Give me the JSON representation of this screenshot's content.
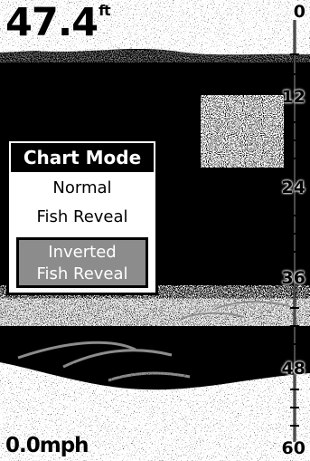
{
  "depth": {
    "value": "47.4",
    "unit": "ft"
  },
  "speed": {
    "value": "0.0mph"
  },
  "depth_scale": {
    "labels": [
      "0",
      "12",
      "24",
      "36",
      "48",
      "60"
    ]
  },
  "chart_mode_menu": {
    "title": "Chart Mode",
    "items": [
      {
        "label": "Normal",
        "selected": false
      },
      {
        "label": "Fish Reveal",
        "selected": false
      },
      {
        "label_line1": "Inverted",
        "label_line2": "Fish Reveal",
        "selected": true
      }
    ]
  },
  "colors": {
    "background": "#000000",
    "noise": "#ffffff",
    "selection": "#8c8c8c"
  }
}
